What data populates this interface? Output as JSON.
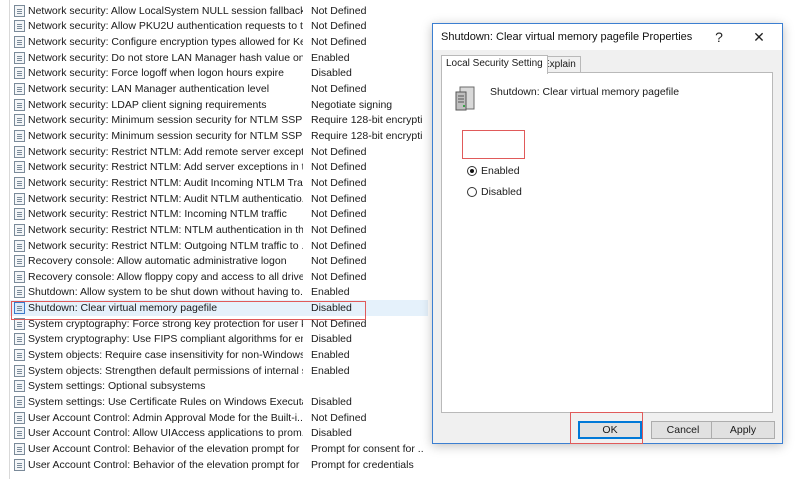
{
  "policy_list": {
    "rows": [
      {
        "name": "Network security: Allow LocalSystem NULL session fallback",
        "setting": "Not Defined"
      },
      {
        "name": "Network security: Allow PKU2U authentication requests to t...",
        "setting": "Not Defined"
      },
      {
        "name": "Network security: Configure encryption types allowed for Ke...",
        "setting": "Not Defined"
      },
      {
        "name": "Network security: Do not store LAN Manager hash value on ...",
        "setting": "Enabled"
      },
      {
        "name": "Network security: Force logoff when logon hours expire",
        "setting": "Disabled"
      },
      {
        "name": "Network security: LAN Manager authentication level",
        "setting": "Not Defined"
      },
      {
        "name": "Network security: LDAP client signing requirements",
        "setting": "Negotiate signing"
      },
      {
        "name": "Network security: Minimum session security for NTLM SSP ...",
        "setting": "Require 128-bit encrypti..."
      },
      {
        "name": "Network security: Minimum session security for NTLM SSP ...",
        "setting": "Require 128-bit encrypti..."
      },
      {
        "name": "Network security: Restrict NTLM: Add remote server excepti...",
        "setting": "Not Defined"
      },
      {
        "name": "Network security: Restrict NTLM: Add server exceptions in t...",
        "setting": "Not Defined"
      },
      {
        "name": "Network security: Restrict NTLM: Audit Incoming NTLM Tra...",
        "setting": "Not Defined"
      },
      {
        "name": "Network security: Restrict NTLM: Audit NTLM authenticatio...",
        "setting": "Not Defined"
      },
      {
        "name": "Network security: Restrict NTLM: Incoming NTLM traffic",
        "setting": "Not Defined"
      },
      {
        "name": "Network security: Restrict NTLM: NTLM authentication in th...",
        "setting": "Not Defined"
      },
      {
        "name": "Network security: Restrict NTLM: Outgoing NTLM traffic to ...",
        "setting": "Not Defined"
      },
      {
        "name": "Recovery console: Allow automatic administrative logon",
        "setting": "Not Defined"
      },
      {
        "name": "Recovery console: Allow floppy copy and access to all drives...",
        "setting": "Not Defined"
      },
      {
        "name": "Shutdown: Allow system to be shut down without having to...",
        "setting": "Enabled"
      },
      {
        "name": "Shutdown: Clear virtual memory pagefile",
        "setting": "Disabled",
        "selected": true
      },
      {
        "name": "System cryptography: Force strong key protection for user k...",
        "setting": "Not Defined"
      },
      {
        "name": "System cryptography: Use FIPS compliant algorithms for en...",
        "setting": "Disabled"
      },
      {
        "name": "System objects: Require case insensitivity for non-Windows ...",
        "setting": "Enabled"
      },
      {
        "name": "System objects: Strengthen default permissions of internal s...",
        "setting": "Enabled"
      },
      {
        "name": "System settings: Optional subsystems",
        "setting": ""
      },
      {
        "name": "System settings: Use Certificate Rules on Windows Executabl...",
        "setting": "Disabled"
      },
      {
        "name": "User Account Control: Admin Approval Mode for the Built-i...",
        "setting": "Not Defined"
      },
      {
        "name": "User Account Control: Allow UIAccess applications to prom...",
        "setting": "Disabled"
      },
      {
        "name": "User Account Control: Behavior of the elevation prompt for ...",
        "setting": "Prompt for consent for ..."
      },
      {
        "name": "User Account Control: Behavior of the elevation prompt for ...",
        "setting": "Prompt for credentials"
      }
    ]
  },
  "dialog": {
    "title": "Shutdown: Clear virtual memory pagefile Properties",
    "help_label": "?",
    "close_label": "✕",
    "tabs": [
      {
        "label": "Local Security Setting",
        "active": true
      },
      {
        "label": "Explain",
        "active": false
      }
    ],
    "policy_name": "Shutdown: Clear virtual memory pagefile",
    "options": {
      "enabled_label": "Enabled",
      "disabled_label": "Disabled",
      "selected": "Enabled"
    },
    "buttons": {
      "ok": "OK",
      "cancel": "Cancel",
      "apply": "Apply"
    }
  },
  "colors": {
    "highlight": "#e05a5a",
    "selection": "#e5f1fb",
    "accent": "#0078d7"
  }
}
